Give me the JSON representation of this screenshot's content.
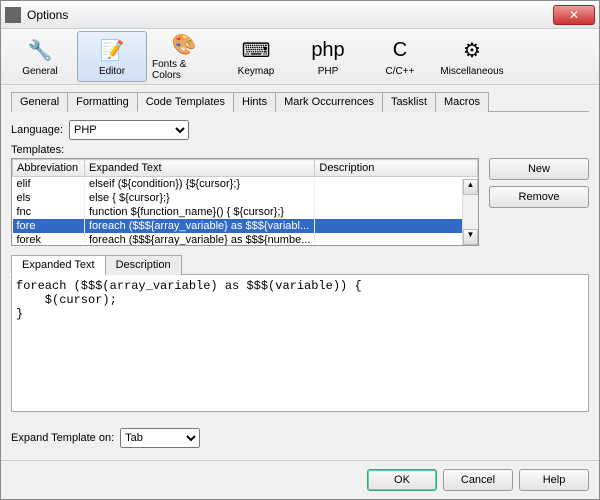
{
  "window": {
    "title": "Options"
  },
  "toolbar": {
    "items": [
      {
        "label": "General",
        "icon": "🔧"
      },
      {
        "label": "Editor",
        "icon": "📝"
      },
      {
        "label": "Fonts & Colors",
        "icon": "🎨"
      },
      {
        "label": "Keymap",
        "icon": "⌨"
      },
      {
        "label": "PHP",
        "icon": "php"
      },
      {
        "label": "C/C++",
        "icon": "C"
      },
      {
        "label": "Miscellaneous",
        "icon": "⚙"
      }
    ]
  },
  "subtabs": [
    "General",
    "Formatting",
    "Code Templates",
    "Hints",
    "Mark Occurrences",
    "Tasklist",
    "Macros"
  ],
  "language": {
    "label": "Language:",
    "value": "PHP"
  },
  "templates_label": "Templates:",
  "columns": [
    "Abbreviation",
    "Expanded Text",
    "Description"
  ],
  "rows": [
    {
      "abbr": "elif",
      "exp": "elseif (${condition}) {${cursor};}",
      "desc": ""
    },
    {
      "abbr": "els",
      "exp": "else {   ${cursor};}",
      "desc": ""
    },
    {
      "abbr": "fnc",
      "exp": "function ${function_name}() {   ${cursor};}",
      "desc": ""
    },
    {
      "abbr": "fore",
      "exp": "foreach ($$${array_variable} as $$${variabl...",
      "desc": ""
    },
    {
      "abbr": "forek",
      "exp": "foreach ($$${array_variable} as $$${numbe...",
      "desc": ""
    }
  ],
  "selected_row": 3,
  "side": {
    "new": "New",
    "remove": "Remove"
  },
  "detail_tabs": [
    "Expanded Text",
    "Description"
  ],
  "code": "foreach ($$$(array_variable) as $$$(variable)) {\n    $(cursor);\n}",
  "expand": {
    "label": "Expand Template on:",
    "value": "Tab"
  },
  "footer": {
    "ok": "OK",
    "cancel": "Cancel",
    "help": "Help"
  }
}
